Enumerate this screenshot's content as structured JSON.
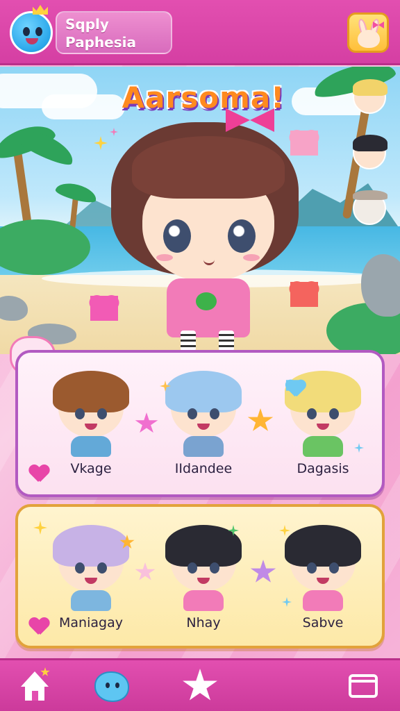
{
  "header": {
    "avatar_icon": "blue-blob-avatar-icon",
    "user_line1": "Sqply",
    "user_line2": "Paphesia",
    "corner_icon": "bunny-face-icon"
  },
  "scene": {
    "title": "Aarsoma!",
    "side_avatars": [
      "blonde-girl-avatar",
      "dark-hair-girl-avatar",
      "bunny-avatar"
    ],
    "badge_icon": "pink-cloud-badge-icon"
  },
  "card1": {
    "characters": [
      {
        "name": "Vkage",
        "hair": "#9b5a2f"
      },
      {
        "name": "IIdandee",
        "hair": "#9cc8ef"
      },
      {
        "name": "Dagasis",
        "hair": "#f2dc7a"
      }
    ],
    "heart_icon": "heart-icon"
  },
  "card2": {
    "characters": [
      {
        "name": "Maniagay",
        "hair": "#c7b2e6"
      },
      {
        "name": "Nhay",
        "hair": "#2a2a33"
      },
      {
        "name": "Sabve",
        "hair": "#2a2a33"
      }
    ],
    "heart_icon": "heart-icon"
  },
  "nav": {
    "items": [
      "home-icon",
      "cloud-friend-icon",
      "star-icon",
      "window-icon"
    ]
  },
  "colors": {
    "primary_pink": "#e24fb0",
    "card1_border": "#b25ac1",
    "card2_border": "#e2a23b"
  }
}
